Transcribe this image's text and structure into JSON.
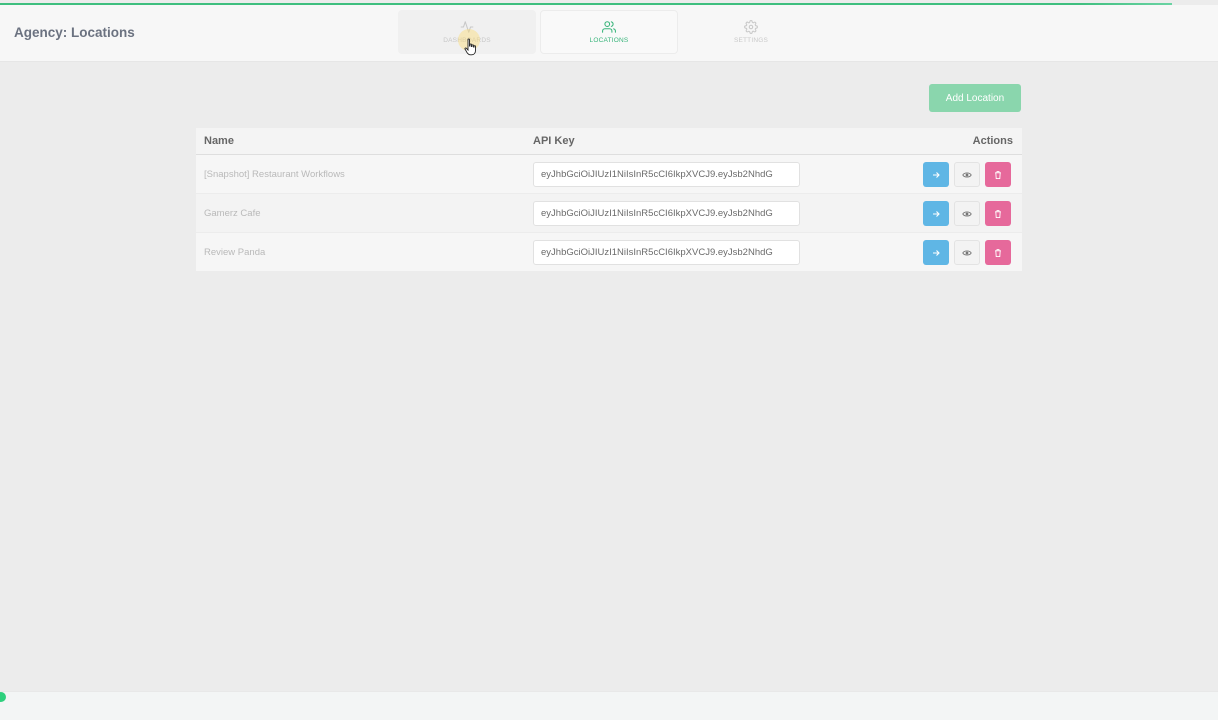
{
  "header": {
    "title": "Agency: Locations",
    "tabs": [
      {
        "label": "DASHBOARDS",
        "icon": "activity-icon"
      },
      {
        "label": "LOCATIONS",
        "icon": "users-icon"
      },
      {
        "label": "SETTINGS",
        "icon": "gear-icon"
      }
    ],
    "active_tab": "LOCATIONS"
  },
  "toolbar": {
    "add_location_label": "Add Location"
  },
  "table": {
    "columns": [
      "Name",
      "API Key",
      "Actions"
    ],
    "rows": [
      {
        "name": "[Snapshot] Restaurant Workflows",
        "api_key": "eyJhbGciOiJIUzI1NiIsInR5cCI6IkpXVCJ9.eyJsb2NhdG"
      },
      {
        "name": "Gamerz Cafe",
        "api_key": "eyJhbGciOiJIUzI1NiIsInR5cCI6IkpXVCJ9.eyJsb2NhdG"
      },
      {
        "name": "Review Panda",
        "api_key": "eyJhbGciOiJIUzI1NiIsInR5cCI6IkpXVCJ9.eyJsb2NhdG"
      }
    ]
  },
  "colors": {
    "accent_green": "#38b47a",
    "add_button": "#8ad6ad",
    "go_button": "#5fb6e5",
    "delete_button": "#e6699b"
  }
}
